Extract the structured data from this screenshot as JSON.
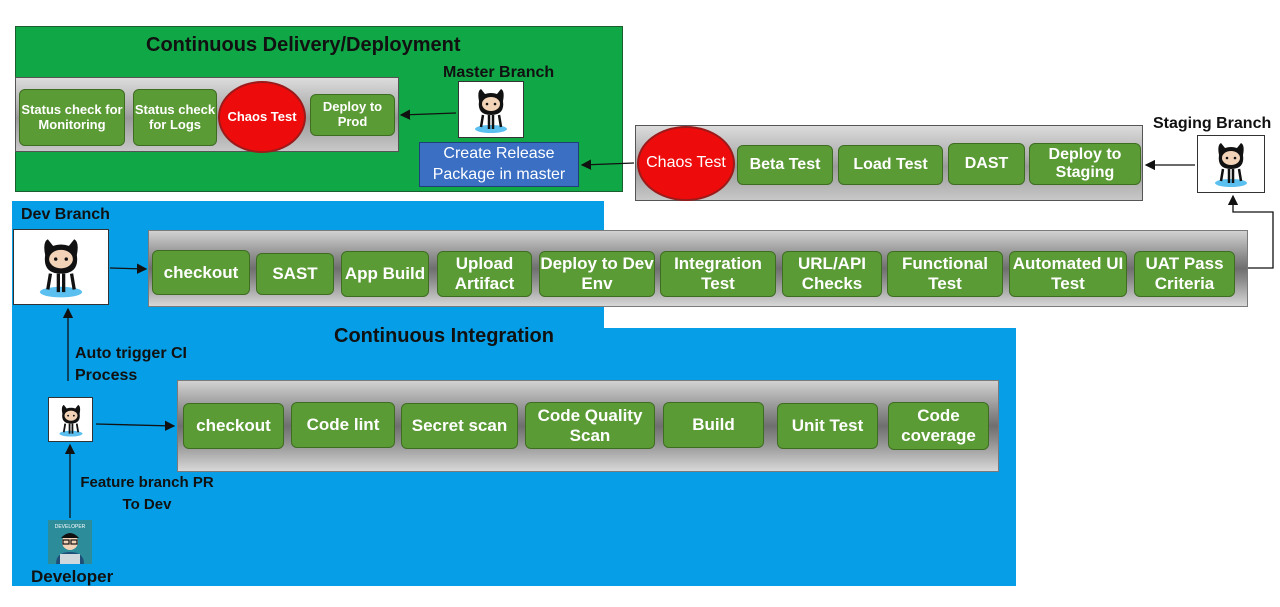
{
  "continuous_delivery": {
    "title": "Continuous Delivery/Deployment",
    "steps": [
      {
        "label": "Status check for Monitoring"
      },
      {
        "label": "Status check for Logs"
      },
      {
        "label": "Chaos Test"
      },
      {
        "label": "Deploy to Prod"
      }
    ],
    "master_branch_label": "Master Branch",
    "release_box": "Create Release Package in master"
  },
  "staging": {
    "branch_label": "Staging Branch",
    "steps": [
      {
        "label": "Chaos Test"
      },
      {
        "label": "Beta Test"
      },
      {
        "label": "Load Test"
      },
      {
        "label": "DAST"
      },
      {
        "label": "Deploy to Staging"
      }
    ]
  },
  "dev": {
    "branch_label": "Dev Branch",
    "steps": [
      {
        "label": "checkout"
      },
      {
        "label": "SAST"
      },
      {
        "label": "App Build"
      },
      {
        "label": "Upload Artifact"
      },
      {
        "label": "Deploy to Dev Env"
      },
      {
        "label": "Integration Test"
      },
      {
        "label": "URL/API Checks"
      },
      {
        "label": "Functional Test"
      },
      {
        "label": "Automated UI Test"
      },
      {
        "label": "UAT Pass Criteria"
      }
    ]
  },
  "continuous_integration": {
    "title": "Continuous Integration",
    "auto_trigger_label": "Auto trigger CI Process",
    "steps": [
      {
        "label": "checkout"
      },
      {
        "label": "Code lint"
      },
      {
        "label": "Secret scan"
      },
      {
        "label": "Code Quality Scan"
      },
      {
        "label": "Build"
      },
      {
        "label": "Unit Test"
      },
      {
        "label": "Code coverage"
      }
    ],
    "feature_pr_label": "Feature branch PR To Dev",
    "developer_label": "Developer",
    "developer_badge": "DEVELOPER"
  },
  "colors": {
    "cd_panel": "#10a746",
    "ci_panel": "#069ee6",
    "step_green": "#5b9b35",
    "chaos_red": "#ee0b0b",
    "release_blue": "#3a6fc4"
  }
}
